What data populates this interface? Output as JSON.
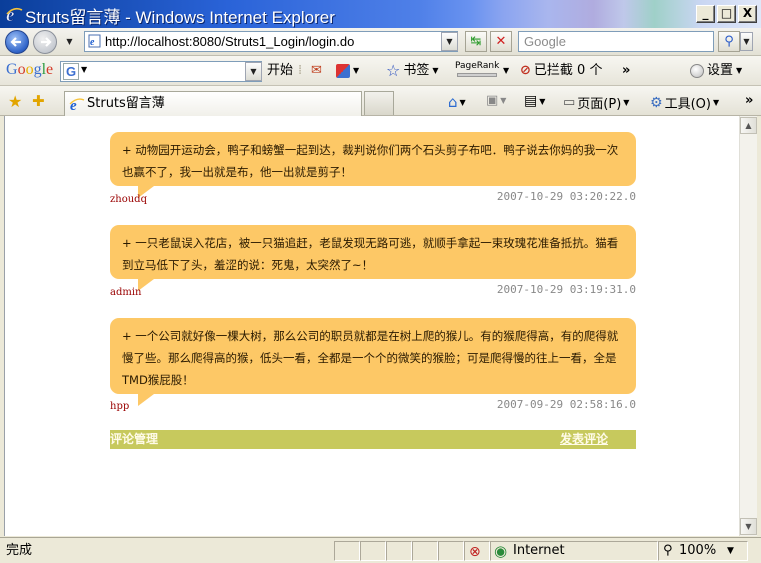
{
  "window": {
    "title": "Struts留言薄 - Windows Internet Explorer",
    "minimize": "_",
    "maximize": "□",
    "close": "X"
  },
  "address_bar": {
    "url": "http://localhost:8080/Struts1_Login/login.do",
    "search_placeholder": "Google"
  },
  "google_toolbar": {
    "logo": "Google",
    "start_label": "开始",
    "bookmarks_label": "书签",
    "pagerank_label": "PageRank",
    "blocked_label": "已拦截 0 个",
    "more_label": "»",
    "settings_label": "设置"
  },
  "tab": {
    "title": "Struts留言薄"
  },
  "command_bar": {
    "page_label": "页面(P)",
    "tools_label": "工具(O)",
    "more_label": "»"
  },
  "messages": [
    {
      "text": "+ 动物园开运动会，鸭子和螃蟹一起到达，裁判说你们两个石头剪子布吧．鸭子说去你妈的我一次也赢不了，我一出就是布，他一出就是剪子！",
      "author": "zhoudq",
      "time": "2007-10-29 03:20:22.0"
    },
    {
      "text": "+ 一只老鼠误入花店，被一只猫追赶，老鼠发现无路可逃，就顺手拿起一束玫瑰花准备抵抗。猫看到立马低下了头，羞涩的说：死鬼，太突然了~！",
      "author": "admin",
      "time": "2007-10-29 03:19:31.0"
    },
    {
      "text": "+ 一个公司就好像一棵大树，那么公司的职员就都是在树上爬的猴儿。有的猴爬得高，有的爬得就慢了些。那么爬得高的猴，低头一看，全都是一个个的微笑的猴脸；可是爬得慢的往上一看，全是TMD猴屁股！",
      "author": "hpp",
      "time": "2007-09-29 02:58:16.0"
    }
  ],
  "footer": {
    "manage_label": "评论管理",
    "post_label": "发表评论"
  },
  "status_bar": {
    "status": "完成",
    "zone": "Internet",
    "zoom": "100%"
  },
  "colors": {
    "bubble": "#fdc866",
    "footer_bar": "#c7c95d",
    "author": "#990000"
  }
}
